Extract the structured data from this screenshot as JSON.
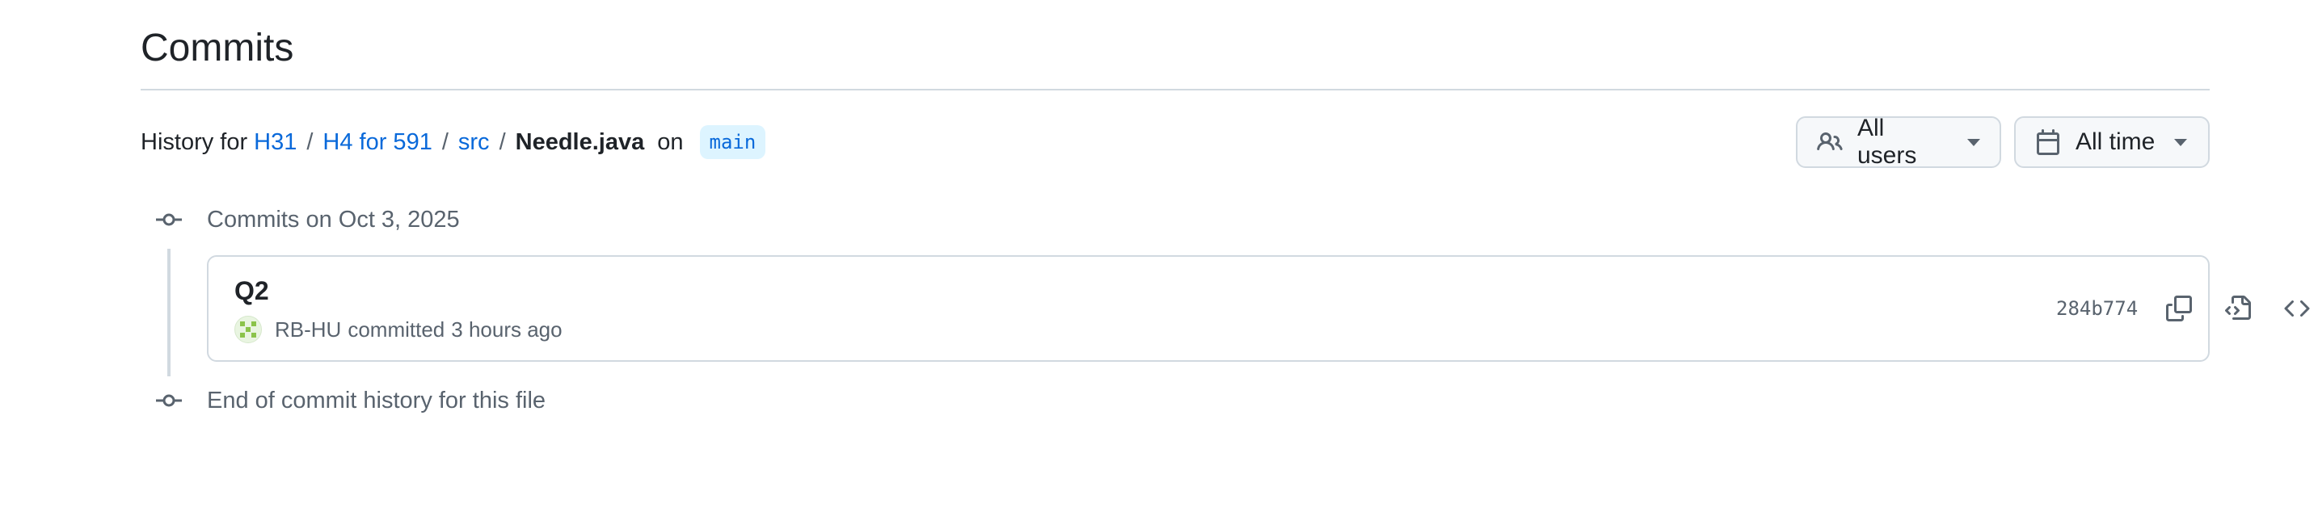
{
  "header": {
    "title": "Commits"
  },
  "history": {
    "prefix": "History for",
    "path": [
      "H31",
      "H4 for 591",
      "src"
    ],
    "separator": "/",
    "file": "Needle.java",
    "on_label": "on",
    "branch": "main"
  },
  "filters": {
    "users_label": "All users",
    "time_label": "All time",
    "users_icon": "people-icon",
    "time_icon": "calendar-icon"
  },
  "timeline": {
    "group_heading": "Commits on Oct 3, 2025",
    "end_text": "End of commit history for this file"
  },
  "commits": [
    {
      "title": "Q2",
      "author": "RB-HU",
      "action": "committed",
      "time": "3 hours ago",
      "sha": "284b774"
    }
  ],
  "colors": {
    "link": "#0969da",
    "muted": "#59636e",
    "border": "#d1d9e0",
    "branch_bg": "#ddf4ff",
    "button_bg": "#f6f8fa"
  }
}
